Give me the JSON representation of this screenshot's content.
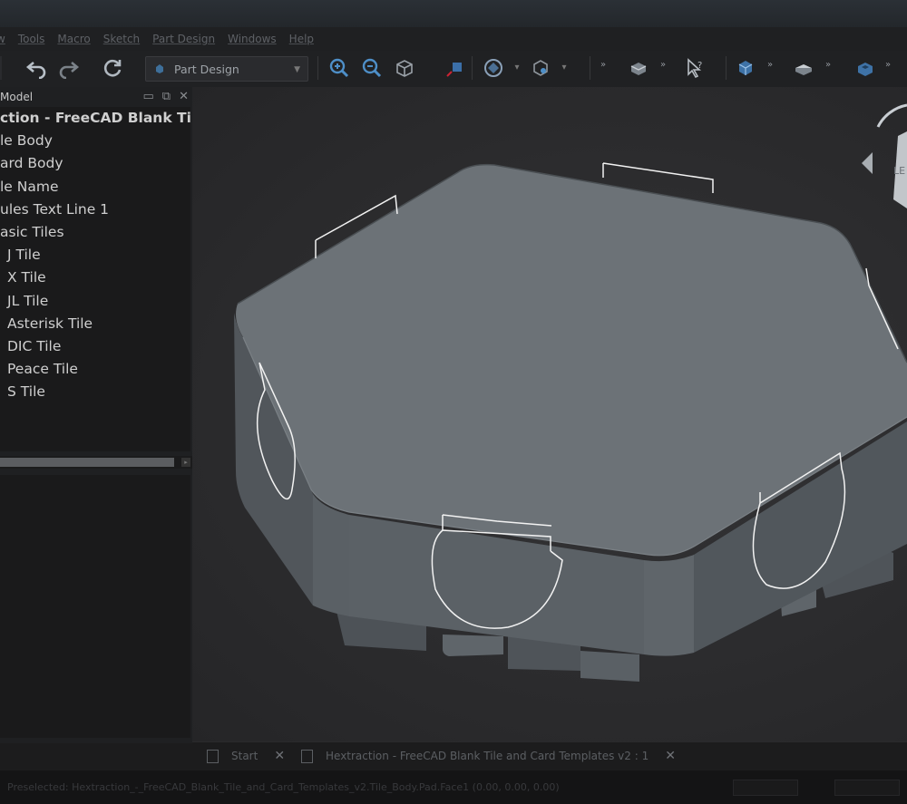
{
  "menu": [
    "w",
    "Tools",
    "Macro",
    "Sketch",
    "Part Design",
    "Windows",
    "Help"
  ],
  "toolbar": {
    "workbench": "Part Design",
    "icons": [
      "undo-icon",
      "redo-icon",
      "refresh-icon",
      "zoom-in-icon",
      "zoom-out-icon",
      "view-box-icon",
      "measure-icon",
      "std-view-icon",
      "draw-style-icon",
      "part-icon",
      "sketch-icon",
      "whats-this-icon",
      "body-icon",
      "pad-icon",
      "pocket-icon"
    ]
  },
  "tree_panel": {
    "title": "Model",
    "root": "ction - FreeCAD Blank Til...",
    "items": [
      "le Body",
      "ard Body",
      "le Name",
      "ules Text Line 1",
      "asic Tiles",
      "J Tile",
      "X Tile",
      "JL Tile",
      "Asterisk Tile",
      "DIC Tile",
      "Peace Tile",
      "S Tile"
    ]
  },
  "viewport": {
    "navcube_label": "LE"
  },
  "tabs": [
    {
      "label": "Start"
    },
    {
      "label": "Hextraction - FreeCAD Blank Tile and Card Templates v2 : 1"
    }
  ],
  "status": {
    "text": "Preselected: Hextraction_-_FreeCAD_Blank_Tile_and_Card_Templates_v2.Tile_Body.Pad.Face1 (0.00, 0.00, 0.00)"
  },
  "colors": {
    "background": "#1c1c1d",
    "top_face": "#6a7075",
    "side_face": "#545a5f"
  }
}
